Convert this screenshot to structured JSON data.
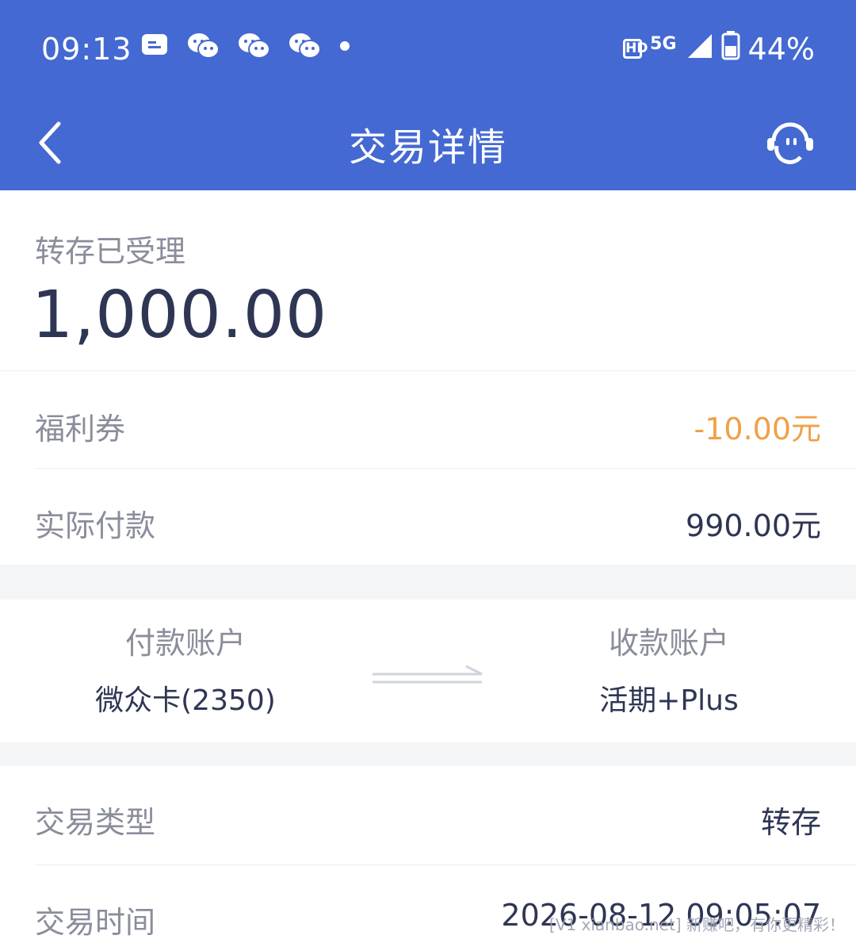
{
  "status_bar": {
    "time": "09:13",
    "hd_label": "HD",
    "network_label": "5G",
    "battery": "44%",
    "icons": [
      "message-icon",
      "wechat-icon",
      "wechat-icon",
      "wechat-icon",
      "dot-icon",
      "signal-icon",
      "battery-icon"
    ]
  },
  "nav": {
    "title": "交易详情",
    "back_icon": "chevron-left-icon",
    "support_icon": "customer-service-icon"
  },
  "summary": {
    "status_label": "转存已受理",
    "amount": "1,000.00"
  },
  "rows": {
    "coupon_label": "福利券",
    "coupon_value": "-10.00元",
    "paid_label": "实际付款",
    "paid_value": "990.00元"
  },
  "accounts": {
    "from_label": "付款账户",
    "from_value": "微众卡(2350)",
    "to_label": "收款账户",
    "to_value": "活期+Plus"
  },
  "details": {
    "type_label": "交易类型",
    "type_value": "转存",
    "time_label": "交易时间",
    "time_value": "2026-08-12 09:05:07"
  },
  "watermark": "[V1 xianbao.net] 新赚吧，有你更精彩！",
  "colors": {
    "header": "#4469d2",
    "accent_orange": "#f0a047",
    "text_dark": "#2f3654",
    "text_gray": "#8a8d9a"
  }
}
